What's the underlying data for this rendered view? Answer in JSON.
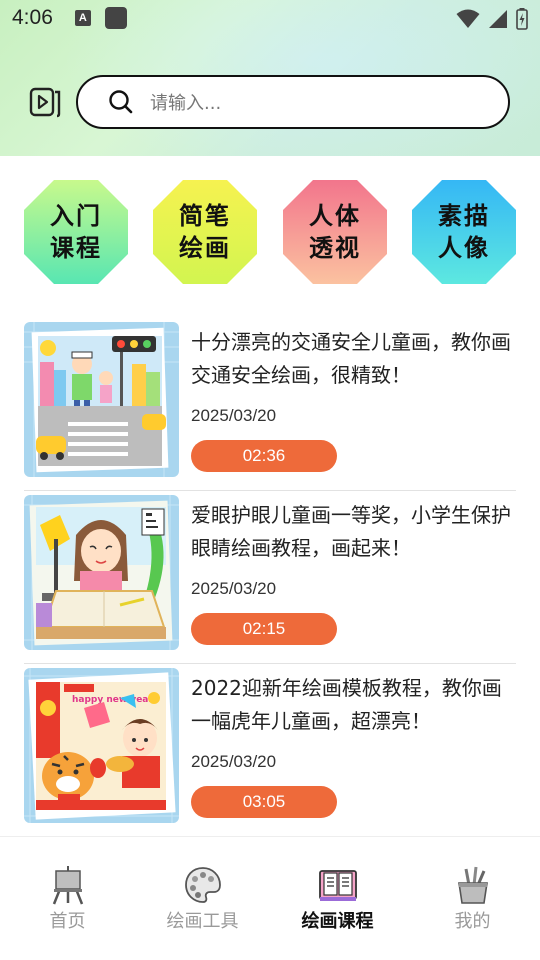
{
  "status_bar": {
    "time": "4:06",
    "notif_letter": "A"
  },
  "search": {
    "placeholder": "请输入..."
  },
  "categories": [
    {
      "label": "入门课程",
      "color_top": "#c8f98c",
      "color_bottom": "#58e6b2"
    },
    {
      "label": "简笔绘画",
      "color_top": "#f6f250",
      "color_bottom": "#d2f550"
    },
    {
      "label": "人体透视",
      "color_top": "#f2758c",
      "color_bottom": "#fbc2a0"
    },
    {
      "label": "素描人像",
      "color_top": "#35b7f5",
      "color_bottom": "#5de8e0"
    }
  ],
  "videos": [
    {
      "title": "十分漂亮的交通安全儿童画，教你画交通安全绘画，很精致！",
      "date": "2025/03/20",
      "duration": "02:36"
    },
    {
      "title": "爱眼护眼儿童画一等奖，小学生保护眼睛绘画教程，画起来！",
      "date": "2025/03/20",
      "duration": "02:15"
    },
    {
      "title": "2022迎新年绘画模板教程，教你画一幅虎年儿童画，超漂亮！",
      "date": "2025/03/20",
      "duration": "03:05"
    }
  ],
  "thumbnails": [
    {
      "subject": "traffic-safety-drawing",
      "caption": ""
    },
    {
      "subject": "eye-care-drawing",
      "caption": ""
    },
    {
      "subject": "new-year-tiger-drawing",
      "caption": "happy new year"
    }
  ],
  "bottom_nav": [
    {
      "label": "首页",
      "icon": "easel-icon",
      "active": false
    },
    {
      "label": "绘画工具",
      "icon": "palette-icon",
      "active": false
    },
    {
      "label": "绘画课程",
      "icon": "book-icon",
      "active": true
    },
    {
      "label": "我的",
      "icon": "pencil-cup-icon",
      "active": false
    }
  ],
  "colors": {
    "accent": "#ee6a3a",
    "active_text": "#111111",
    "inactive_text": "#9a9a9a"
  }
}
